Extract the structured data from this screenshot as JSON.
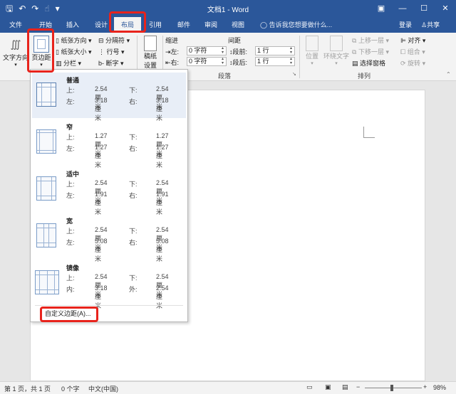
{
  "titlebar": {
    "title": "文档1 - Word",
    "save_icon": "🖫",
    "undo_icon": "↶",
    "redo_icon": "↷",
    "touch_icon": "☝",
    "more_icon": "▾",
    "ribbon_opts_icon": "▣",
    "min_icon": "—",
    "max_icon": "☐",
    "close_icon": "✕"
  },
  "tabs": [
    "文件",
    "开始",
    "插入",
    "设计",
    "布局",
    "引用",
    "邮件",
    "审阅",
    "视图"
  ],
  "tellme": "告诉我您想要做什么...",
  "login": "登录",
  "share": "共享",
  "ribbon": {
    "text_direction": "文字方向",
    "margins": "页边距",
    "orientation": "纸张方向",
    "size": "纸张大小",
    "columns": "分栏",
    "breaks": "分隔符",
    "line_numbers": "行号",
    "hyphenation": "断字",
    "draft_paper_1": "稿纸",
    "draft_paper_2": "设置",
    "indent": "缩进",
    "spacing": "间距",
    "left_label": "左:",
    "right_label": "右:",
    "left_value": "0 字符",
    "right_value": "0 字符",
    "before_label": "段前:",
    "after_label": "段后:",
    "before_value": "1 行",
    "after_value": "1 行",
    "paragraph_group": "段落",
    "position": "位置",
    "wrap_text": "环绕文字",
    "bring_forward": "上移一层",
    "send_backward": "下移一层",
    "selection_pane": "选择窗格",
    "align": "对齐",
    "group": "组合",
    "rotate": "旋转",
    "arrange_group": "排列"
  },
  "margins_menu": {
    "items": [
      {
        "name": "普通",
        "k1": "上:",
        "v1": "2.54 厘米",
        "k2": "下:",
        "v2": "2.54 厘米",
        "k3": "左:",
        "v3": "3.18 厘米",
        "k4": "右:",
        "v4": "3.18 厘米"
      },
      {
        "name": "窄",
        "k1": "上:",
        "v1": "1.27 厘米",
        "k2": "下:",
        "v2": "1.27 厘米",
        "k3": "左:",
        "v3": "1.27 厘米",
        "k4": "右:",
        "v4": "1.27 厘米"
      },
      {
        "name": "适中",
        "k1": "上:",
        "v1": "2.54 厘米",
        "k2": "下:",
        "v2": "2.54 厘米",
        "k3": "左:",
        "v3": "1.91 厘米",
        "k4": "右:",
        "v4": "1.91 厘米"
      },
      {
        "name": "宽",
        "k1": "上:",
        "v1": "2.54 厘米",
        "k2": "下:",
        "v2": "2.54 厘米",
        "k3": "左:",
        "v3": "5.08 厘米",
        "k4": "右:",
        "v4": "5.08 厘米"
      },
      {
        "name": "镜像",
        "k1": "上:",
        "v1": "2.54 厘米",
        "k2": "下:",
        "v2": "2.54 厘米",
        "k3": "内:",
        "v3": "3.18 厘米",
        "k4": "外:",
        "v4": "2.54 厘米"
      }
    ],
    "custom": "自定义边距(A)..."
  },
  "statusbar": {
    "page": "第 1 页，共 1 页",
    "words": "0 个字",
    "lang": "中文(中国)",
    "zoom": "98%"
  },
  "colors": {
    "brand": "#2b579a",
    "highlight": "#e8231c"
  }
}
